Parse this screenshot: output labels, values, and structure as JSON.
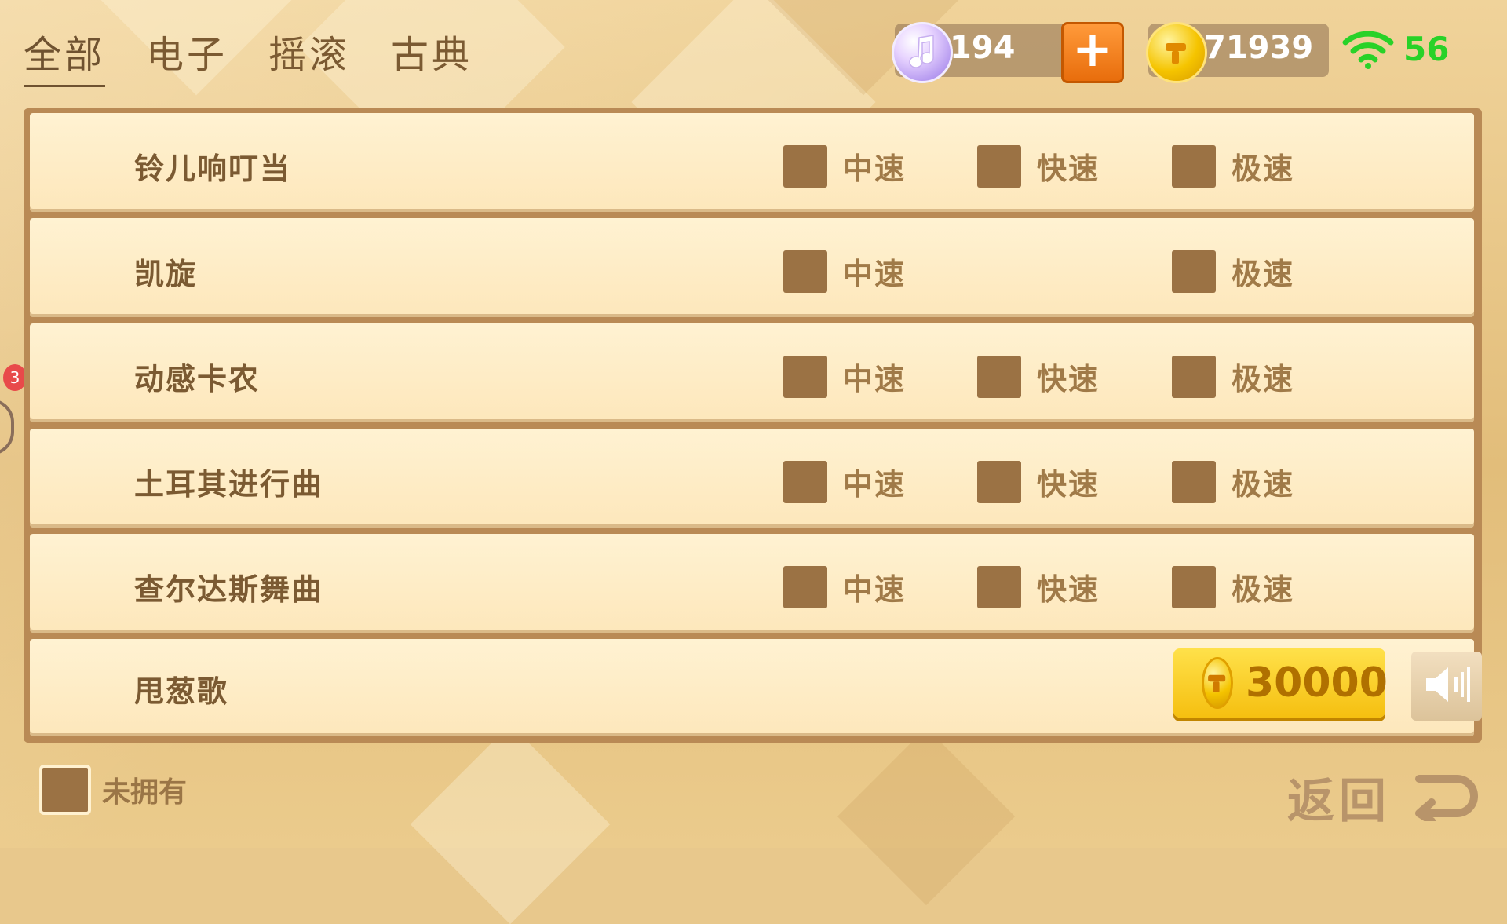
{
  "tabs": [
    "全部",
    "电子",
    "摇滚",
    "古典"
  ],
  "stats": {
    "notes": "194",
    "plus": "+",
    "coins": "71939",
    "signal": "56"
  },
  "colors": {
    "accent": "#f5bf10",
    "checkbox": "#9b7244",
    "text": "#7b5a32",
    "signal": "#28d228",
    "plus": "#e86d0c"
  },
  "songs": [
    {
      "name": "铃儿响叮当",
      "options": [
        "中速",
        "快速",
        "极速"
      ]
    },
    {
      "name": "凯旋",
      "options": [
        "中速",
        "",
        "极速"
      ]
    },
    {
      "name": "动感卡农",
      "options": [
        "中速",
        "快速",
        "极速"
      ]
    },
    {
      "name": "土耳其进行曲",
      "options": [
        "中速",
        "快速",
        "极速"
      ]
    },
    {
      "name": "查尔达斯舞曲",
      "options": [
        "中速",
        "快速",
        "极速"
      ]
    }
  ],
  "locked_song": {
    "name": "甩葱歌",
    "price": "30000"
  },
  "legend": {
    "label": "未拥有"
  },
  "back": {
    "label": "返回"
  },
  "badge": {
    "count": "3"
  },
  "icons": {
    "note": "music-note-icon",
    "coin": "gold-coin-icon",
    "wifi": "wifi-icon",
    "sound": "speaker-icon",
    "back": "return-arrow-icon"
  }
}
